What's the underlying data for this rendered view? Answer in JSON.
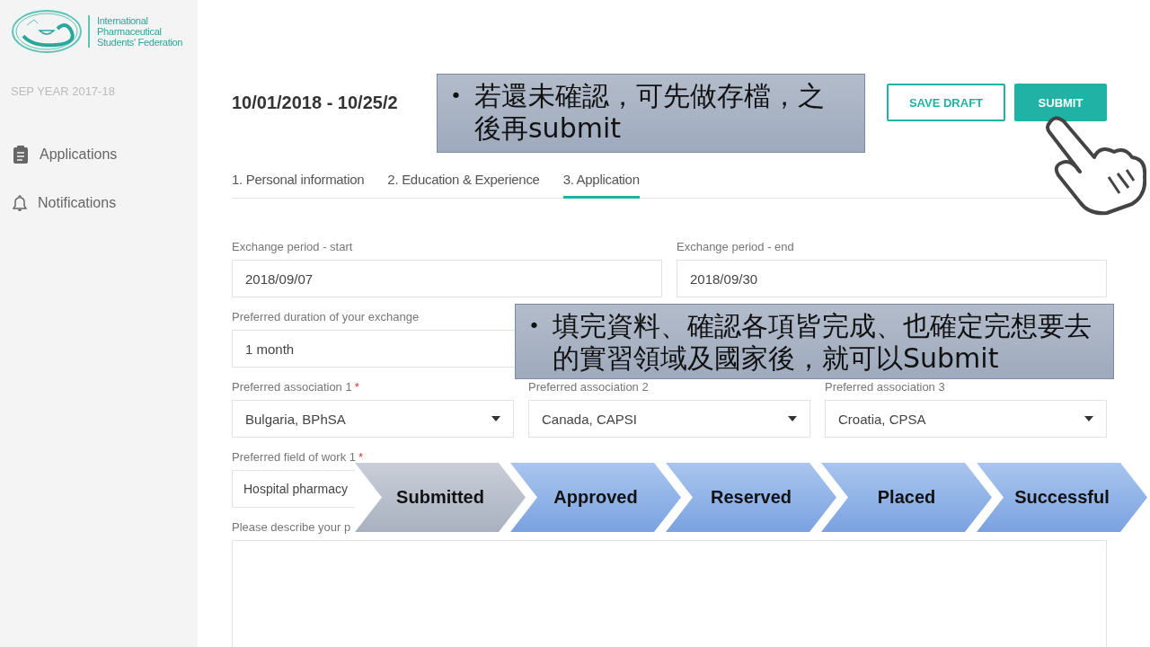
{
  "sidebar": {
    "logo_lines": [
      "International",
      "Pharmaceutical",
      "Students' Federation"
    ],
    "year": "SEP YEAR 2017-18",
    "items": [
      {
        "label": "Applications",
        "kind": "clipboard"
      },
      {
        "label": "Notifications",
        "kind": "bell"
      }
    ]
  },
  "header": {
    "title": "10/01/2018 - 10/25/2",
    "buttons": [
      {
        "label": "SAVE DRAFT",
        "kind": "outline"
      },
      {
        "label": "SUBMIT",
        "kind": "primary"
      }
    ]
  },
  "tabs": [
    {
      "label": "1. Personal information",
      "selected": false
    },
    {
      "label": "2. Education & Experience",
      "selected": false
    },
    {
      "label": "3. Application",
      "selected": true
    }
  ],
  "form_rows": [
    {
      "fields": [
        {
          "label": "Exchange period - start",
          "value": "2018/09/07",
          "kind": "text"
        },
        {
          "label": "Exchange period - end",
          "value": "2018/09/30",
          "kind": "text"
        }
      ]
    },
    {
      "fields": [
        {
          "label": "Preferred duration of your exchange",
          "value": "1 month",
          "kind": "text"
        }
      ]
    },
    {
      "fields": [
        {
          "label": "Preferred association 1",
          "value": "Bulgaria, BPhSA",
          "kind": "select",
          "marker": "*"
        },
        {
          "label": "Preferred association 2",
          "value": "Canada, CAPSI",
          "kind": "select"
        },
        {
          "label": "Preferred association 3",
          "value": "Croatia, CPSA",
          "kind": "select"
        }
      ]
    },
    {
      "fields": [
        {
          "label": "Preferred field of work 1",
          "value": "Hospital pharmacy",
          "kind": "text",
          "marker": "*"
        }
      ]
    },
    {
      "fields": [
        {
          "label": "Please describe your p",
          "kind": "textarea"
        }
      ]
    }
  ],
  "callouts": [
    {
      "bullet": "•",
      "text": "若還未確認，可先做存檔，之後再submit"
    },
    {
      "bullet": "•",
      "text": "填完資料、確認各項皆完成、也確定完想要去的實習領域及國家後，就可以Submit"
    }
  ],
  "steps": [
    {
      "label": "Submitted",
      "selected": true
    },
    {
      "label": "Approved",
      "selected": false
    },
    {
      "label": "Reserved",
      "selected": false
    },
    {
      "label": "Placed",
      "selected": false
    },
    {
      "label": "Successful",
      "selected": false
    }
  ]
}
